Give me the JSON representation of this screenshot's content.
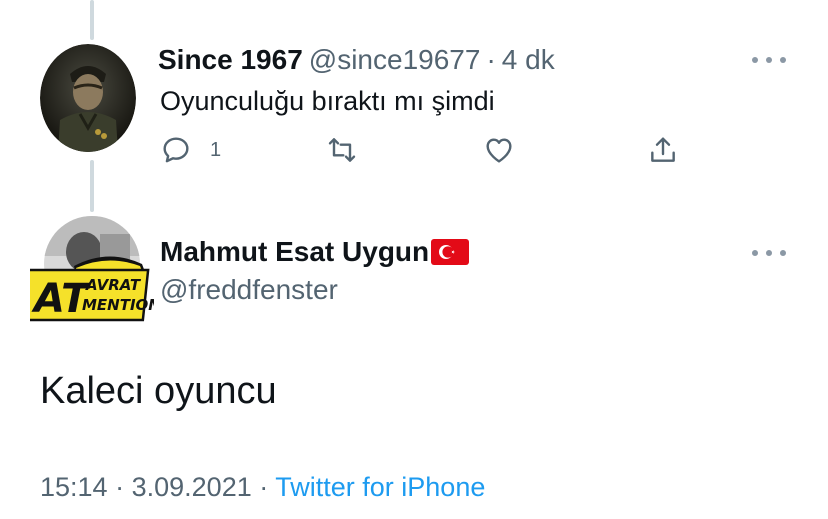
{
  "tweet1": {
    "display_name": "Since 1967",
    "handle": "@since19677",
    "separator": "·",
    "time": "4 dk",
    "text": "Oyunculuğu bıraktı mı şimdi",
    "reply_count": "1",
    "icons": [
      "reply-icon",
      "retweet-icon",
      "like-icon",
      "share-icon",
      "more-icon"
    ]
  },
  "tweet2": {
    "display_name": "Mahmut Esat Uygun",
    "handle": "@freddfenster",
    "text": "Kaleci oyuncu",
    "time": "15:14",
    "separator1": "·",
    "date": "3.09.2021",
    "separator2": "·",
    "source": "Twitter for iPhone",
    "avatar_badge": [
      "AT",
      "AVRAT",
      "MENTION"
    ]
  },
  "colors": {
    "text": "#0f1419",
    "secondary": "#536471",
    "link": "#1d9bf0",
    "thread_line": "#cfd9de",
    "flag_red": "#e30a17",
    "badge_yellow": "#f5e12a"
  }
}
